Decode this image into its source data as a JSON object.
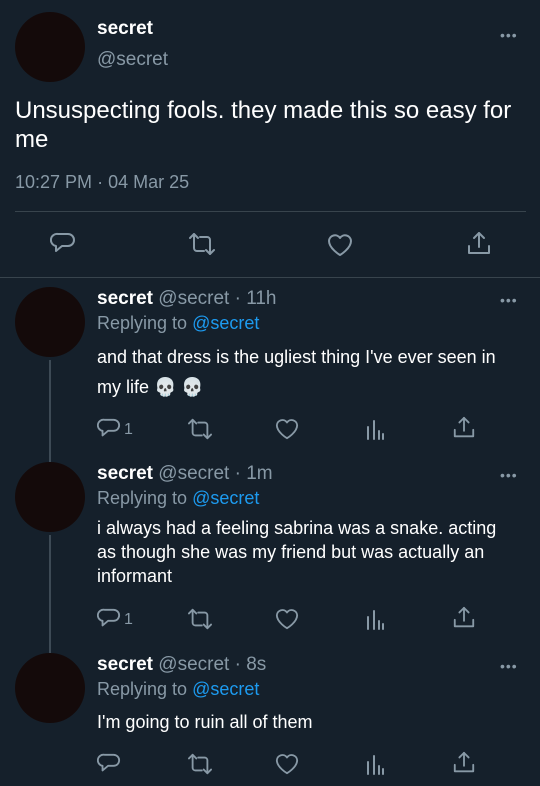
{
  "main_tweet": {
    "display_name": "secret",
    "handle": "@secret",
    "text": "Unsuspecting fools. they made this so easy for me",
    "time": "10:27 PM",
    "sep": "·",
    "date": "04 Mar 25"
  },
  "replies": [
    {
      "display_name": "secret",
      "meta": "@secret · 11h",
      "replying_prefix": "Replying to",
      "replying_handle": "@secret",
      "text": "and that dress is the ugliest thing I've ever seen in my life 💀 💀",
      "reply_count": "1"
    },
    {
      "display_name": "secret",
      "meta": "@secret · 1m",
      "replying_prefix": "Replying to",
      "replying_handle": "@secret",
      "text": "i always had a feeling sabrina was a snake. acting as though she was my friend but was actually an informant",
      "reply_count": "1"
    },
    {
      "display_name": "secret",
      "meta": "@secret · 8s",
      "replying_prefix": "Replying to",
      "replying_handle": "@secret",
      "text": "I'm going to ruin all of them",
      "reply_count": ""
    }
  ],
  "more_label": "•••",
  "icons": {
    "reply": "reply-icon",
    "retweet": "retweet-icon",
    "like": "heart-icon",
    "analytics": "analytics-icon",
    "share": "share-icon"
  },
  "colors": {
    "background": "#15202b",
    "muted": "#8899a6",
    "link": "#1d9bf0",
    "divider": "#38444d"
  }
}
